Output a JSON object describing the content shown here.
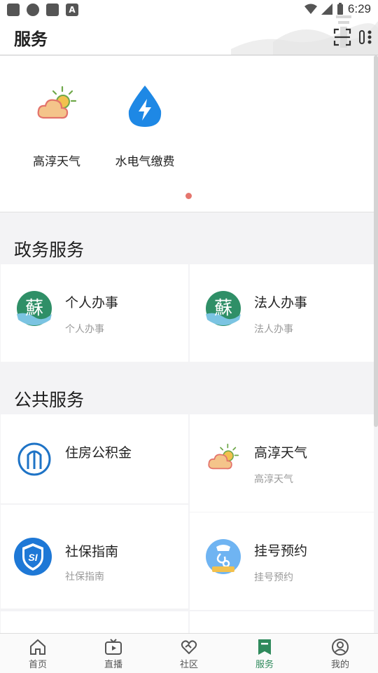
{
  "status_bar": {
    "time": "6:29"
  },
  "header": {
    "title": "服务"
  },
  "banner": {
    "apps": [
      {
        "label": "高淳天气",
        "icon": "weather-icon"
      },
      {
        "label": "水电气缴费",
        "icon": "utility-payment-icon"
      }
    ]
  },
  "sections": {
    "gov": {
      "title": "政务服务",
      "items": [
        {
          "title": "个人办事",
          "subtitle": "个人办事",
          "icon": "su-logo-icon"
        },
        {
          "title": "法人办事",
          "subtitle": "法人办事",
          "icon": "su-logo-icon"
        }
      ]
    },
    "public": {
      "title": "公共服务",
      "items": [
        {
          "title": "住房公积金",
          "subtitle": "",
          "icon": "housing-fund-icon"
        },
        {
          "title": "高淳天气",
          "subtitle": "高淳天气",
          "icon": "weather-icon"
        },
        {
          "title": "社保指南",
          "subtitle": "社保指南",
          "icon": "social-security-shield-icon"
        },
        {
          "title": "挂号预约",
          "subtitle": "挂号预约",
          "icon": "hospital-registration-icon"
        }
      ]
    }
  },
  "nav": {
    "items": [
      {
        "label": "首页",
        "icon": "home-icon"
      },
      {
        "label": "直播",
        "icon": "live-tv-icon"
      },
      {
        "label": "社区",
        "icon": "community-icon"
      },
      {
        "label": "服务",
        "icon": "service-bookmark-icon",
        "active": true
      },
      {
        "label": "我的",
        "icon": "profile-icon"
      }
    ]
  },
  "colors": {
    "accent": "#2f8a5c",
    "dot": "#e5766e",
    "blue": "#1e88e5"
  }
}
